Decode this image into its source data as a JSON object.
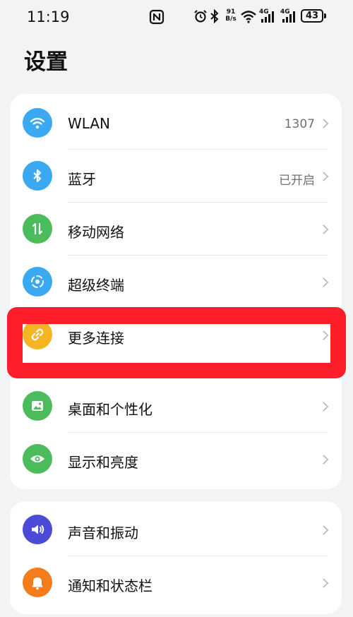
{
  "status_bar": {
    "time": "11:19",
    "network_speed_value": "91",
    "network_speed_unit": "B/s",
    "signal_1_label": "4G",
    "signal_2_label": "4G",
    "battery_level": "43",
    "icons": [
      "nfc-icon",
      "alarm-icon",
      "bluetooth-icon",
      "wifi-icon",
      "signal-icon",
      "signal-icon",
      "battery-icon"
    ]
  },
  "page": {
    "title": "设置"
  },
  "settings": {
    "group_1": [
      {
        "label": "WLAN",
        "value": "1307",
        "icon": "wifi-icon",
        "color": "#3aa9f2"
      },
      {
        "label": "蓝牙",
        "value": "已开启",
        "icon": "bluetooth-icon",
        "color": "#3aa9f2"
      },
      {
        "label": "移动网络",
        "value": "",
        "icon": "mobile-data-icon",
        "color": "#4cbb5c"
      },
      {
        "label": "超级终端",
        "value": "",
        "icon": "super-device-icon",
        "color": "#3aa9f2"
      },
      {
        "label": "更多连接",
        "value": "",
        "icon": "link-icon",
        "color": "#f5b421"
      },
      {
        "label": "桌面和个性化",
        "value": "",
        "icon": "wallpaper-icon",
        "color": "#4cbb5c"
      },
      {
        "label": "显示和亮度",
        "value": "",
        "icon": "eye-icon",
        "color": "#4cbb5c"
      }
    ],
    "group_2": [
      {
        "label": "声音和振动",
        "value": "",
        "icon": "speaker-icon",
        "color": "#4b4bd8"
      },
      {
        "label": "通知和状态栏",
        "value": "",
        "icon": "bell-icon",
        "color": "#f47c1c"
      }
    ]
  },
  "colors": {
    "highlight": "#ff1f2a",
    "background": "#f1f3f5",
    "card": "#ffffff"
  }
}
